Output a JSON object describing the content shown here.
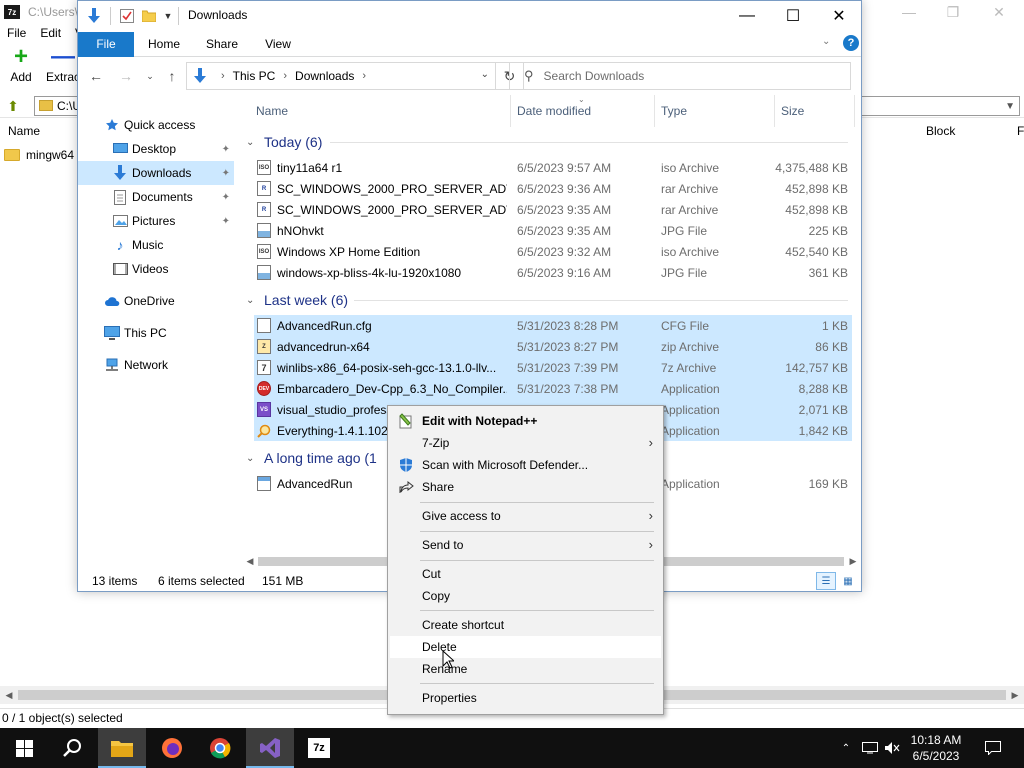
{
  "sevenzip": {
    "title": "C:\\Users\\v",
    "app_icon": "7z",
    "menu": [
      "File",
      "Edit",
      "V"
    ],
    "toolbar": {
      "add": "Add",
      "extract": "Extrac"
    },
    "address": "C:\\U",
    "columns": {
      "name": "Name",
      "block": "Block",
      "last": "F"
    },
    "items": [
      {
        "name": "mingw64"
      }
    ],
    "status": "0 / 1 object(s) selected"
  },
  "explorer": {
    "title": "Downloads",
    "ribbon_tabs": [
      "File",
      "Home",
      "Share",
      "View"
    ],
    "breadcrumb": [
      "This PC",
      "Downloads"
    ],
    "search_placeholder": "Search Downloads",
    "nav": {
      "quick_access": "Quick access",
      "desktop": "Desktop",
      "downloads": "Downloads",
      "documents": "Documents",
      "pictures": "Pictures",
      "music": "Music",
      "videos": "Videos",
      "onedrive": "OneDrive",
      "this_pc": "This PC",
      "network": "Network"
    },
    "columns": {
      "name": "Name",
      "date": "Date modified",
      "type": "Type",
      "size": "Size"
    },
    "groups": [
      {
        "label": "Today (6)",
        "files": [
          {
            "name": "tiny11a64 r1",
            "date": "6/5/2023 9:57 AM",
            "type": "iso Archive",
            "size": "4,375,488 KB",
            "icon": "iso-archive-icon",
            "glyph": "ISO",
            "selected": false
          },
          {
            "name": "SC_WINDOWS_2000_PRO_SERVER_ADVSE...",
            "date": "6/5/2023 9:36 AM",
            "type": "rar Archive",
            "size": "452,898 KB",
            "icon": "rar-archive-icon",
            "glyph": "R",
            "selected": false
          },
          {
            "name": "SC_WINDOWS_2000_PRO_SERVER_ADVSE...",
            "date": "6/5/2023 9:35 AM",
            "type": "rar Archive",
            "size": "452,898 KB",
            "icon": "rar-archive-icon",
            "glyph": "R",
            "selected": false
          },
          {
            "name": "hNOhvkt",
            "date": "6/5/2023 9:35 AM",
            "type": "JPG File",
            "size": "225 KB",
            "icon": "jpg-file-icon",
            "glyph": "",
            "selected": false
          },
          {
            "name": "Windows XP Home Edition",
            "date": "6/5/2023 9:32 AM",
            "type": "iso Archive",
            "size": "452,540 KB",
            "icon": "iso-archive-icon",
            "glyph": "ISO",
            "selected": false
          },
          {
            "name": "windows-xp-bliss-4k-lu-1920x1080",
            "date": "6/5/2023 9:16 AM",
            "type": "JPG File",
            "size": "361 KB",
            "icon": "jpg-file-icon",
            "glyph": "",
            "selected": false
          }
        ]
      },
      {
        "label": "Last week (6)",
        "files": [
          {
            "name": "AdvancedRun.cfg",
            "date": "5/31/2023 8:28 PM",
            "type": "CFG File",
            "size": "1 KB",
            "icon": "cfg-file-icon",
            "glyph": "",
            "selected": true
          },
          {
            "name": "advancedrun-x64",
            "date": "5/31/2023 8:27 PM",
            "type": "zip Archive",
            "size": "86 KB",
            "icon": "zip-archive-icon",
            "glyph": "Z",
            "selected": true
          },
          {
            "name": "winlibs-x86_64-posix-seh-gcc-13.1.0-llv...",
            "date": "5/31/2023 7:39 PM",
            "type": "7z Archive",
            "size": "142,757 KB",
            "icon": "7z-archive-icon",
            "glyph": "7",
            "selected": true
          },
          {
            "name": "Embarcadero_Dev-Cpp_6.3_No_Compiler...",
            "date": "5/31/2023 7:38 PM",
            "type": "Application",
            "size": "8,288 KB",
            "icon": "devcpp-app-icon",
            "glyph": "DEV",
            "selected": true
          },
          {
            "name": "visual_studio_profess",
            "date": "",
            "type": "Application",
            "size": "2,071 KB",
            "icon": "visual-studio-icon",
            "glyph": "VS",
            "selected": true
          },
          {
            "name": "Everything-1.4.1.1024",
            "date": "",
            "type": "Application",
            "size": "1,842 KB",
            "icon": "everything-search-icon",
            "glyph": "",
            "selected": true
          }
        ]
      },
      {
        "label": "A long time ago (1",
        "files": [
          {
            "name": "AdvancedRun",
            "date": "",
            "type": "Application",
            "size": "169 KB",
            "icon": "advancedrun-app-icon",
            "glyph": "",
            "selected": false
          }
        ]
      }
    ],
    "status": {
      "count": "13 items",
      "selected": "6 items selected",
      "size": "151 MB"
    }
  },
  "context_menu": {
    "items": [
      {
        "label": "Edit with Notepad++",
        "icon": "notepad-plus-plus-icon",
        "bold": true,
        "submenu": false
      },
      {
        "label": "7-Zip",
        "icon": "",
        "bold": false,
        "submenu": true
      },
      {
        "label": "Scan with Microsoft Defender...",
        "icon": "defender-shield-icon",
        "bold": false,
        "submenu": false
      },
      {
        "label": "Share",
        "icon": "share-icon",
        "bold": false,
        "submenu": false
      },
      {
        "label": "Give access to",
        "icon": "",
        "bold": false,
        "submenu": true
      },
      {
        "label": "Send to",
        "icon": "",
        "bold": false,
        "submenu": true
      },
      {
        "label": "Cut",
        "icon": "",
        "bold": false,
        "submenu": false
      },
      {
        "label": "Copy",
        "icon": "",
        "bold": false,
        "submenu": false
      },
      {
        "label": "Create shortcut",
        "icon": "",
        "bold": false,
        "submenu": false
      },
      {
        "label": "Delete",
        "icon": "",
        "bold": false,
        "submenu": false,
        "hover": true
      },
      {
        "label": "Rename",
        "icon": "",
        "bold": false,
        "submenu": false
      },
      {
        "label": "Properties",
        "icon": "",
        "bold": false,
        "submenu": false
      }
    ]
  },
  "taskbar": {
    "apps": [
      "start-icon",
      "search-icon",
      "file-explorer-icon",
      "firefox-icon",
      "chrome-icon",
      "visual-studio-icon",
      "7zip-icon"
    ],
    "active_app": "file-explorer-icon",
    "time": "10:18 AM",
    "date": "6/5/2023"
  },
  "colors": {
    "selection": "#cce8ff",
    "file_tab": "#1979ca",
    "group_header": "#1e3287",
    "taskbar": "#101010"
  }
}
